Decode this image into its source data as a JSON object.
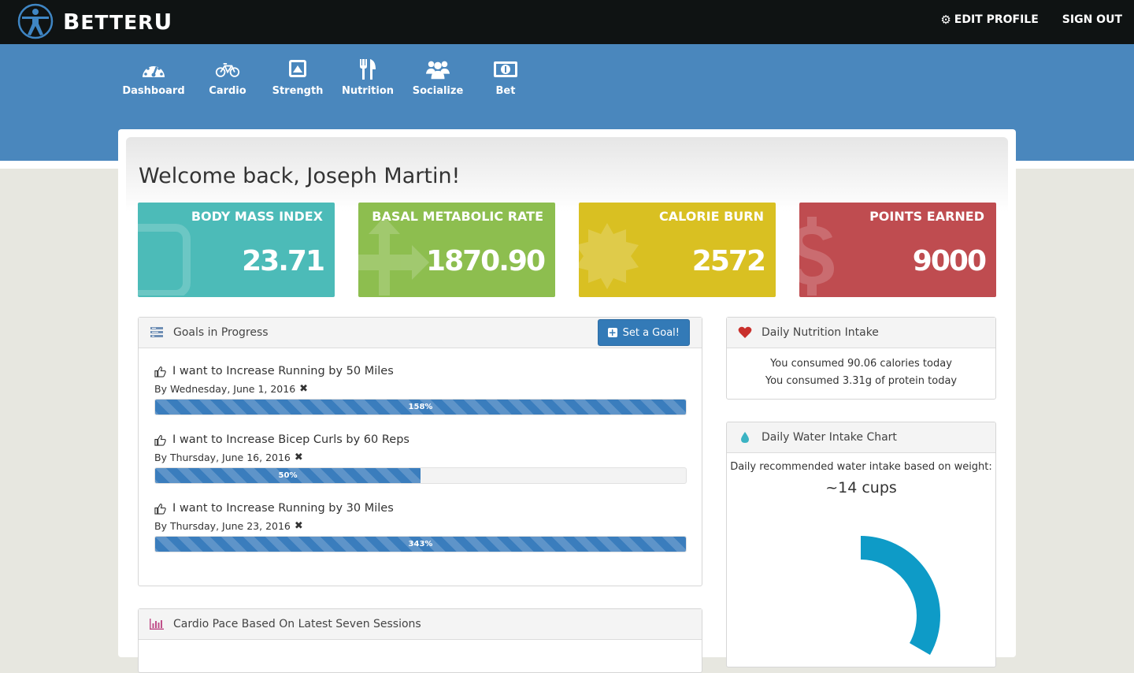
{
  "brand": {
    "first_letter": "B",
    "rest_a": "ETTER",
    "last": "U"
  },
  "topnav": {
    "edit_profile": "EDIT PROFILE",
    "sign_out": "SIGN OUT"
  },
  "nav": {
    "items": [
      {
        "label": "Dashboard",
        "icon": "dashboard-icon"
      },
      {
        "label": "Cardio",
        "icon": "bicycle-icon"
      },
      {
        "label": "Strength",
        "icon": "caret-square-up-icon"
      },
      {
        "label": "Nutrition",
        "icon": "cutlery-icon"
      },
      {
        "label": "Socialize",
        "icon": "users-icon"
      },
      {
        "label": "Bet",
        "icon": "money-icon"
      }
    ]
  },
  "welcome": "Welcome back, Joseph Martin!",
  "stats": [
    {
      "label": "BODY MASS INDEX",
      "value": "23.71",
      "color": "#4cbbb8"
    },
    {
      "label": "BASAL METABOLIC RATE",
      "value": "1870.90",
      "color": "#8dbe4f"
    },
    {
      "label": "CALORIE BURN",
      "value": "2572",
      "color": "#d9c022"
    },
    {
      "label": "POINTS EARNED",
      "value": "9000",
      "color": "#bf4c50"
    }
  ],
  "goals_panel": {
    "title": "Goals in Progress",
    "button": "Set a Goal!",
    "goals": [
      {
        "title": "I want to Increase Running by 50 Miles",
        "date": "By Wednesday, June 1, 2016",
        "progress_label": "158%",
        "progress": 158
      },
      {
        "title": "I want to Increase Bicep Curls by 60 Reps",
        "date": "By Thursday, June 16, 2016",
        "progress_label": "50%",
        "progress": 50
      },
      {
        "title": "I want to Increase Running by 30 Miles",
        "date": "By Thursday, June 23, 2016",
        "progress_label": "343%",
        "progress": 343
      }
    ]
  },
  "cardio_panel": {
    "title": "Cardio Pace Based On Latest Seven Sessions"
  },
  "nutrition_panel": {
    "title": "Daily Nutrition Intake",
    "line1": "You consumed 90.06 calories today",
    "line2": "You consumed 3.31g of protein today"
  },
  "water_panel": {
    "title": "Daily Water Intake Chart",
    "subtitle": "Daily recommended water intake based on weight:",
    "value": "~14 cups",
    "ring_color": "#0e9bc7"
  }
}
